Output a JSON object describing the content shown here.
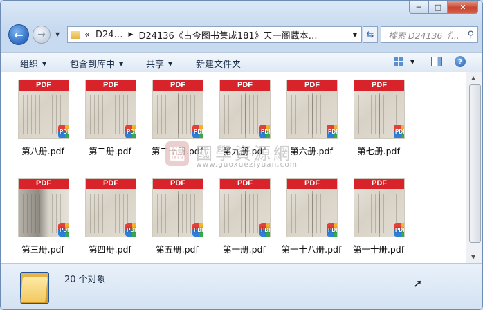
{
  "window": {
    "caption_buttons": {
      "minimize": "─",
      "maximize": "□",
      "close": "✕"
    }
  },
  "nav": {
    "address_overflow": "«",
    "address_parts": [
      "D24…",
      "D24136《古今图书集成181》天一阁藏本…"
    ],
    "search_placeholder": "搜索 D24136《..."
  },
  "toolbar": {
    "organize": "组织",
    "include_in_library": "包含到库中",
    "share": "共享",
    "new_folder": "新建文件夹"
  },
  "files": [
    {
      "name": "第八册.pdf",
      "thumb": "light"
    },
    {
      "name": "第二册.pdf",
      "thumb": "light"
    },
    {
      "name": "第二十册.pdf",
      "thumb": "light"
    },
    {
      "name": "第九册.pdf",
      "thumb": "light"
    },
    {
      "name": "第六册.pdf",
      "thumb": "light"
    },
    {
      "name": "第七册.pdf",
      "thumb": "light"
    },
    {
      "name": "第三册.pdf",
      "thumb": "dark"
    },
    {
      "name": "第四册.pdf",
      "thumb": "light"
    },
    {
      "name": "第五册.pdf",
      "thumb": "light"
    },
    {
      "name": "第一册.pdf",
      "thumb": "light"
    },
    {
      "name": "第一十八册.pdf",
      "thumb": "light"
    },
    {
      "name": "第一十册.pdf",
      "thumb": "light"
    }
  ],
  "pdf_banner": "PDF",
  "pdf_badge": "PDF",
  "watermark": {
    "seal": "臨",
    "chinese": "國學資源網",
    "url": "www.guoxueziyuan.com"
  },
  "status": {
    "object_count": "20 个对象"
  },
  "colors": {
    "pdf_red": "#d8232a",
    "accent_blue": "#2c6cc4"
  }
}
